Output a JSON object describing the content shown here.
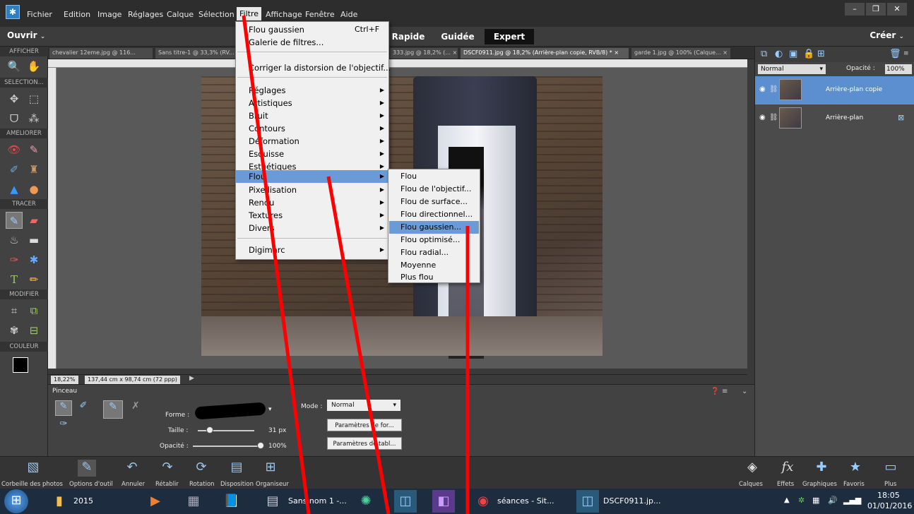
{
  "app": {
    "menus": [
      "Fichier",
      "Edition",
      "Image",
      "Réglages",
      "Calque",
      "Sélection",
      "Filtre",
      "Affichage",
      "Fenêtre",
      "Aide"
    ],
    "window_controls": [
      "–",
      "❐",
      "✕"
    ]
  },
  "toolbar": {
    "open_label": "Ouvrir",
    "create_label": "Créer",
    "modes": [
      "Rapide",
      "Guidée",
      "Expert"
    ],
    "active_mode": "Expert"
  },
  "doc_tabs": [
    "chevalier 12eme.jpg @ 116...",
    "Sans titre-1 @ 33,3% (RV...",
    "333.jpg @ 18,2% (... ×",
    "DSCF0911.jpg @ 18,2% (Arrière-plan copie, RVB/8) * ×",
    "garde 1.jpg @ 100% (Calque... ×"
  ],
  "left_panel": {
    "sections": [
      "AFFICHER",
      "SELECTION...",
      "AMELIORER",
      "TRACER",
      "MODIFIER",
      "COULEUR"
    ]
  },
  "status": {
    "zoom": "18,22%",
    "size": "137,44 cm x 98,74 cm (72 ppp)"
  },
  "filter_menu": {
    "items": [
      {
        "label": "Flou gaussien",
        "shortcut": "Ctrl+F"
      },
      {
        "label": "Galerie de filtres..."
      },
      {
        "label": "Corriger la distorsion de l'objectif..."
      },
      {
        "label": "Réglages"
      },
      {
        "label": "Artistiques"
      },
      {
        "label": "Bruit"
      },
      {
        "label": "Contours"
      },
      {
        "label": "Déformation"
      },
      {
        "label": "Esquisse"
      },
      {
        "label": "Esthétiques"
      },
      {
        "label": "Flou"
      },
      {
        "label": "Pixellisation"
      },
      {
        "label": "Rendu"
      },
      {
        "label": "Textures"
      },
      {
        "label": "Divers"
      },
      {
        "label": "Digimarc"
      }
    ]
  },
  "blur_submenu": {
    "items": [
      "Flou",
      "Flou de l'objectif...",
      "Flou de surface...",
      "Flou directionnel...",
      "Flou gaussien...",
      "Flou optimisé...",
      "Flou radial...",
      "Moyenne",
      "Plus flou"
    ],
    "highlighted": "Flou gaussien..."
  },
  "layers_panel": {
    "blend_mode": "Normal",
    "opacity_label": "Opacité :",
    "opacity_value": "100%",
    "layers": [
      {
        "name": "Arrière-plan copie",
        "selected": true
      },
      {
        "name": "Arrière-plan",
        "selected": false
      }
    ]
  },
  "tool_options": {
    "tool_name": "Pinceau",
    "shape_label": "Forme :",
    "size_label": "Taille :",
    "size_value": "31 px",
    "opacity_label": "Opacité :",
    "opacity_value": "100%",
    "mode_label": "Mode :",
    "mode_value": "Normal",
    "btn_form_params": "Paramètres de for...",
    "btn_tablet_params": "Paramètres de tabl..."
  },
  "bottom_bar": {
    "left_items": [
      "Corbeille des photos",
      "Options d'outil",
      "Annuler",
      "Rétablir",
      "Rotation",
      "Disposition",
      "Organiseur"
    ],
    "right_items": [
      "Calques",
      "Effets",
      "Graphiques",
      "Favoris",
      "Plus"
    ]
  },
  "taskbar": {
    "items": [
      "2015",
      "Sans nom 1 -...",
      "séances - Sit...",
      "DSCF0911.jp..."
    ],
    "time": "18:05",
    "date": "01/01/2016"
  },
  "colors": {
    "menu_highlight": "#6b9bd6",
    "annotation_line": "#ff0000",
    "layer_selected": "#5b8fd0"
  }
}
